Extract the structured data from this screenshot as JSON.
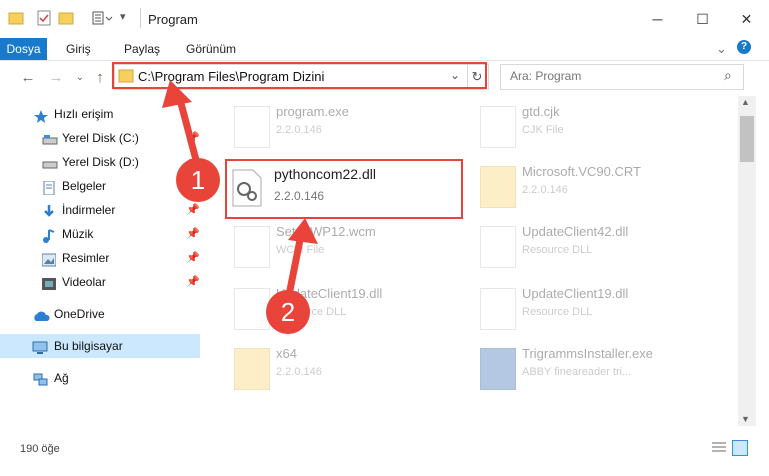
{
  "window": {
    "title": "Program",
    "minimize": "─",
    "maximize": "☐",
    "close": "✕"
  },
  "ribbon": {
    "tabs": [
      "Dosya",
      "Giriş",
      "Paylaş",
      "Görünüm"
    ],
    "expand": "⌄",
    "help": "?"
  },
  "nav": {
    "back": "←",
    "forward": "→",
    "dropdown": "⌄",
    "up": "↑",
    "refresh": "↻"
  },
  "address": {
    "path": "C:\\Program Files\\Program Dizini",
    "dropdown": "⌄"
  },
  "search": {
    "placeholder": "Ara: Program",
    "icon": "⌕"
  },
  "sidebar": {
    "items": [
      {
        "label": "Hızlı erişim",
        "icon": "star-icon"
      },
      {
        "label": "Yerel Disk (C:)",
        "icon": "drive-icon",
        "pinned": true
      },
      {
        "label": "Yerel Disk (D:)",
        "icon": "drive-icon",
        "pinned": true
      },
      {
        "label": "Belgeler",
        "icon": "documents-icon",
        "pinned": true
      },
      {
        "label": "İndirmeler",
        "icon": "download-icon",
        "pinned": true
      },
      {
        "label": "Müzik",
        "icon": "music-icon",
        "pinned": true
      },
      {
        "label": "Resimler",
        "icon": "pictures-icon",
        "pinned": true
      },
      {
        "label": "Videolar",
        "icon": "videos-icon",
        "pinned": true
      },
      {
        "label": "OneDrive",
        "icon": "cloud-icon"
      },
      {
        "label": "Bu bilgisayar",
        "icon": "computer-icon",
        "selected": true
      },
      {
        "label": "Ağ",
        "icon": "network-icon"
      }
    ]
  },
  "files": [
    {
      "name": "program.exe",
      "meta": "2.2.0.146"
    },
    {
      "name": "gtd.cjk",
      "meta": "CJK File"
    },
    {
      "name": "pythoncom22.dll",
      "meta": "2.2.0.146",
      "highlighted": true
    },
    {
      "name": "Microsoft.VC90.CRT",
      "meta": "2.2.0.146"
    },
    {
      "name": "SetupWP12.wcm",
      "meta": "WCM File"
    },
    {
      "name": "UpdateClient42.dll",
      "meta": "Resource DLL"
    },
    {
      "name": "UpdateClient19.dll",
      "meta": "Resource DLL"
    },
    {
      "name": "UpdateClient19.dll",
      "meta": "Resource DLL"
    },
    {
      "name": "x64",
      "meta": "2.2.0.146"
    },
    {
      "name": "TrigrammsInstaller.exe",
      "meta": "ABBY fineareader tri..."
    }
  ],
  "annotations": {
    "step1": "1",
    "step2": "2",
    "color": "#e8443a"
  },
  "status": {
    "count": "190 öğe"
  },
  "colors": {
    "accent": "#1979ca",
    "highlight": "#e8443a",
    "selected": "#cce8ff"
  }
}
